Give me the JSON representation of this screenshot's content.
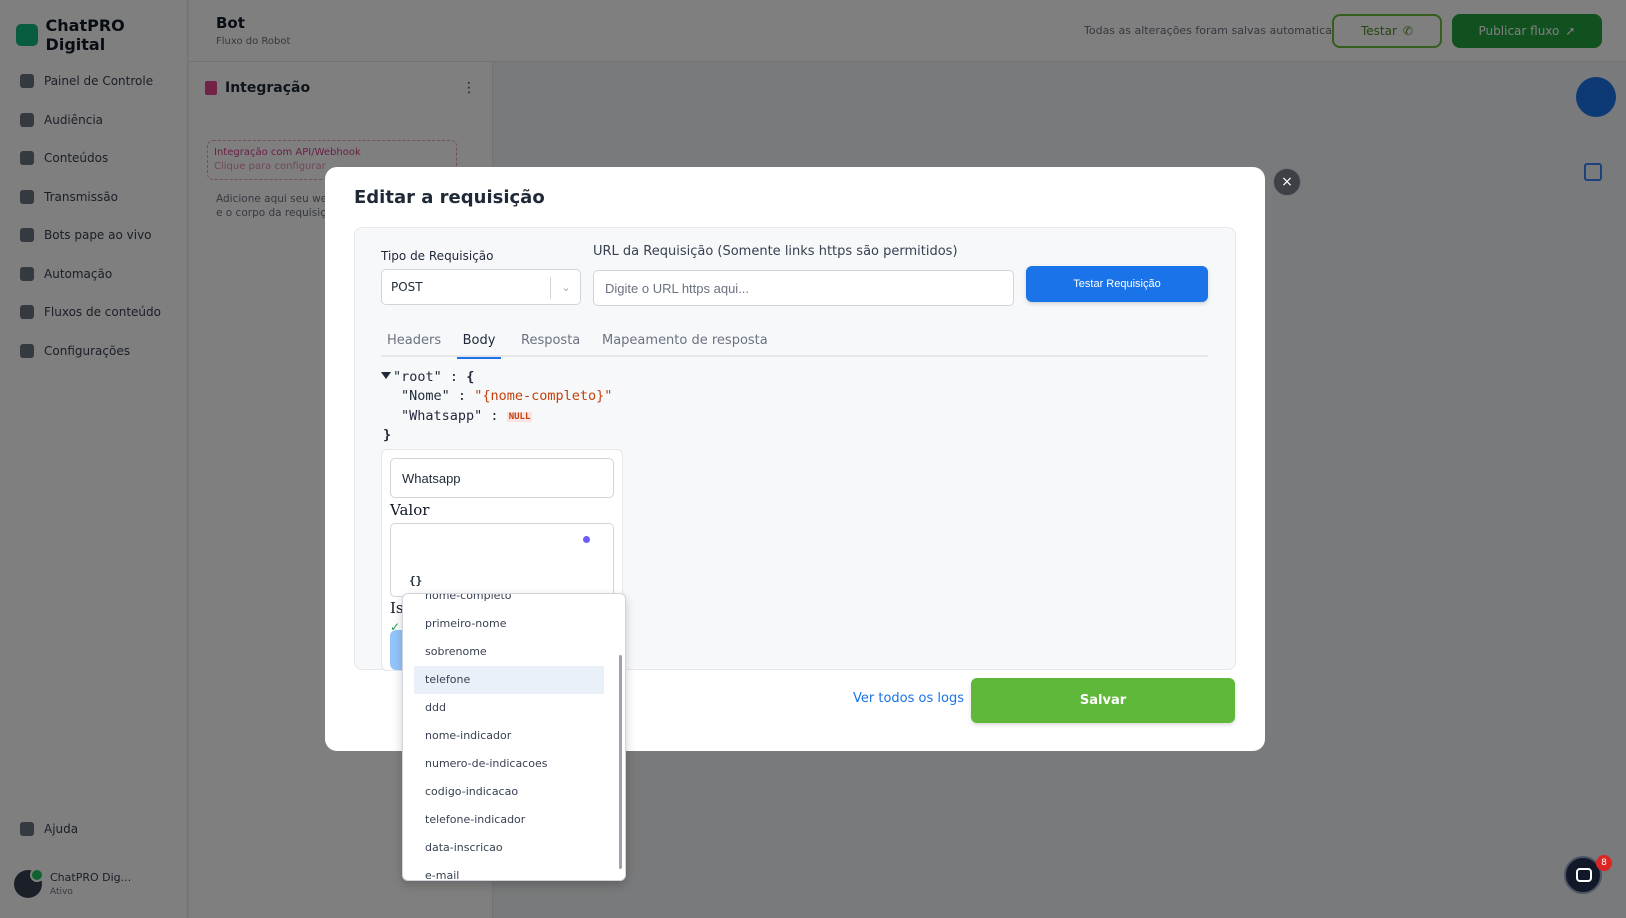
{
  "app": {
    "brand": "ChatPRO Digital",
    "nav": [
      "Painel de Controle",
      "Audiência",
      "Conteúdos",
      "Transmissão",
      "Bots pape ao vivo",
      "Automação",
      "Fluxos de conteúdo",
      "Configurações"
    ],
    "help": "Ajuda",
    "user_name": "ChatPRO Dig...",
    "user_sub": "Ativo"
  },
  "topbar": {
    "title": "Bot",
    "subtitle": "Fluxo do Robot",
    "status": "Todas as alterações foram salvas automaticamente",
    "btn_test": "Testar",
    "btn_publish": "Publicar fluxo"
  },
  "panel": {
    "title": "Integração",
    "card_line1": "Integração com API/Webhook",
    "card_line2": "Clique para configurar",
    "description": "Adicione aqui seu webhook, configure headers e o corpo da requisição para integrar seu fluxo."
  },
  "modal": {
    "title": "Editar a requisição",
    "close": "×",
    "type_label": "Tipo de Requisição",
    "type_value": "POST",
    "type_chevron": "⌄",
    "url_label": "URL da Requisição (Somente links https são permitidos)",
    "url_placeholder": "Digite o URL https aqui...",
    "test_button": "Testar Requisição",
    "tabs": [
      "Headers",
      "Body",
      "Resposta",
      "Mapeamento de resposta"
    ],
    "json": {
      "root_key": "\"root\"",
      "open": "{",
      "close": "}",
      "colon": ":",
      "rows": [
        {
          "key": "\"Nome\"",
          "value": "\"{nome-completo}\""
        },
        {
          "key": "\"Whatsapp\"",
          "value": "NULL"
        }
      ]
    },
    "editor": {
      "key_value": "Whatsapp",
      "valor_label": "Valor",
      "braces": "{}",
      "is_label": "Is",
      "check": "✓"
    },
    "logs_link": "Ver todos os logs",
    "save_button": "Salvar"
  },
  "dropdown": {
    "options": [
      "nome-completo",
      "primeiro-nome",
      "sobrenome",
      "telefone",
      "ddd",
      "nome-indicador",
      "numero-de-indicacoes",
      "codigo-indicacao",
      "telefone-indicador",
      "data-inscricao",
      "e-mail"
    ],
    "highlighted": "telefone"
  },
  "chat": {
    "badge": "8"
  },
  "colors": {
    "accent_blue": "#1a73e8",
    "save_green": "#5fb83a",
    "json_string": "#c2410c"
  }
}
